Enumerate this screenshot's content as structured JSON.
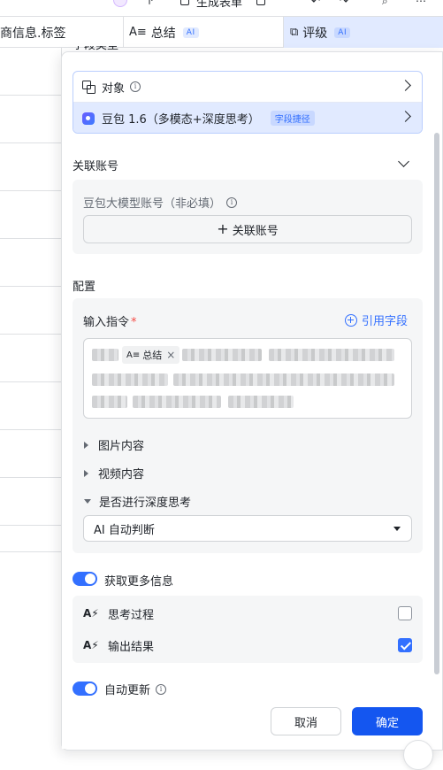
{
  "toolbar": {
    "generate_form_label": "生成表单"
  },
  "columns": [
    {
      "title": "商信息.标签"
    },
    {
      "title": "总结",
      "tag": "AI",
      "icon": "text-lines-icon"
    },
    {
      "title": "评级",
      "tag": "AI",
      "icon": "copy-icon"
    }
  ],
  "panel": {
    "field_type_section_title": "字段类型",
    "field_type_options": [
      {
        "label": "对象"
      },
      {
        "label": "豆包 1.6（多模态+深度思考）",
        "tag": "字段捷径"
      }
    ],
    "linked_account": {
      "title": "关联账号",
      "account_label": "豆包大模型账号（非必填）",
      "link_button": "关联账号"
    },
    "config": {
      "title": "配置",
      "instruction_label": "输入指令",
      "required_mark": "*",
      "reference_field": "引用字段",
      "chip_label": "总结",
      "image_content": "图片内容",
      "video_content": "视频内容",
      "deep_thinking_label": "是否进行深度思考",
      "deep_thinking_value": "AI 自动判断"
    },
    "more_info": {
      "label": "获取更多信息",
      "enabled": true,
      "options": [
        {
          "label": "思考过程",
          "checked": false
        },
        {
          "label": "输出结果",
          "checked": true
        }
      ]
    },
    "auto_update": {
      "label": "自动更新",
      "enabled": true
    },
    "cancel_label": "取消",
    "confirm_label": "确定"
  },
  "colors": {
    "accent": "#3370ff",
    "primary_button": "#1456f0",
    "selected_row": "#e1eaff"
  }
}
